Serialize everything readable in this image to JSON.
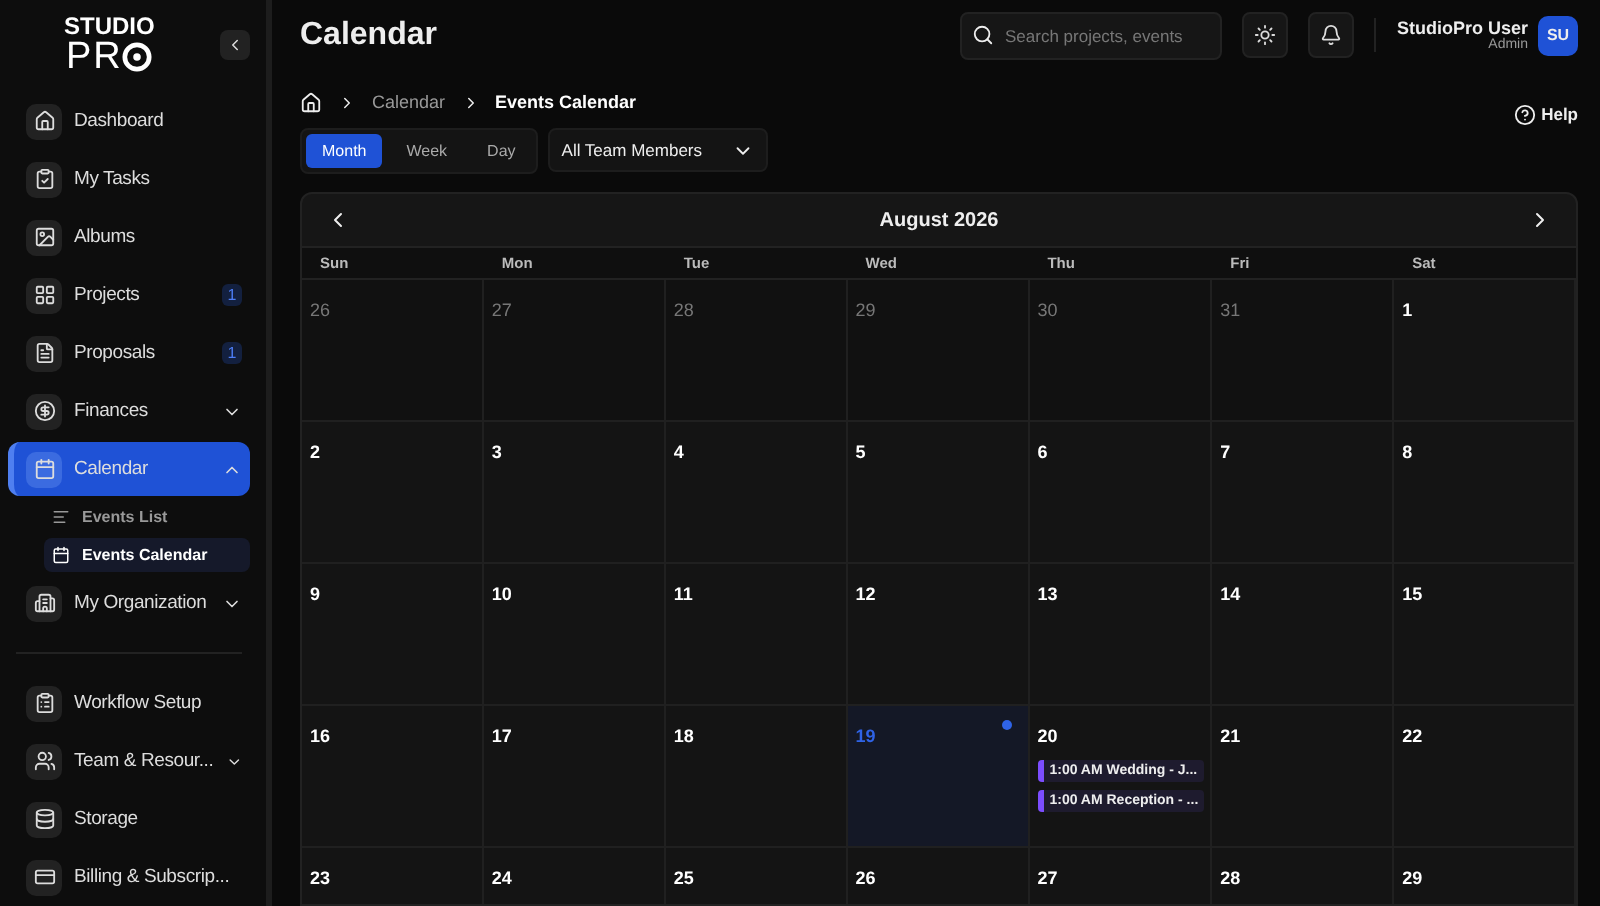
{
  "logo": {
    "line1": "STUDIO",
    "line2": "PR"
  },
  "sidebar": {
    "items": [
      {
        "label": "Dashboard",
        "selected": false
      },
      {
        "label": "My Tasks",
        "selected": false
      },
      {
        "label": "Albums",
        "selected": false
      },
      {
        "label": "Projects",
        "badge": "1",
        "selected": false
      },
      {
        "label": "Proposals",
        "badge": "1",
        "selected": false
      },
      {
        "label": "Finances",
        "expanded": false,
        "selected": false
      },
      {
        "label": "Calendar",
        "expanded": true,
        "selected": true,
        "children": [
          {
            "label": "Events List",
            "selected": false
          },
          {
            "label": "Events Calendar",
            "selected": true
          }
        ]
      },
      {
        "label": "My Organization",
        "expanded": false,
        "selected": false
      }
    ],
    "bottom_items": [
      {
        "label": "Workflow Setup",
        "selected": false
      },
      {
        "label": "Team & Resour...",
        "expanded": false,
        "selected": false
      },
      {
        "label": "Storage",
        "selected": false
      },
      {
        "label": "Billing & Subscrip...",
        "selected": false
      }
    ]
  },
  "header": {
    "title": "Calendar",
    "search": {
      "placeholder": "Search projects, events"
    },
    "user": {
      "name": "StudioPro User",
      "role": "Admin",
      "initials": "SU"
    }
  },
  "breadcrumb": [
    "Calendar",
    "Events Calendar"
  ],
  "help": "Help",
  "view_tabs": [
    {
      "label": "Month",
      "selected": true
    },
    {
      "label": "Week",
      "selected": false
    },
    {
      "label": "Day",
      "selected": false
    }
  ],
  "member_filter": "All Team Members",
  "calendar": {
    "month": "August 2026",
    "weekdays": [
      "Sun",
      "Mon",
      "Tue",
      "Wed",
      "Thu",
      "Fri",
      "Sat"
    ],
    "weeks": [
      [
        {
          "day": "26",
          "outside": true
        },
        {
          "day": "27",
          "outside": true
        },
        {
          "day": "28",
          "outside": true
        },
        {
          "day": "29",
          "outside": true
        },
        {
          "day": "30",
          "outside": true
        },
        {
          "day": "31",
          "outside": true
        },
        {
          "day": "1",
          "outside": false
        }
      ],
      [
        {
          "day": "2",
          "outside": false
        },
        {
          "day": "3",
          "outside": false
        },
        {
          "day": "4",
          "outside": false
        },
        {
          "day": "5",
          "outside": false
        },
        {
          "day": "6",
          "outside": false
        },
        {
          "day": "7",
          "outside": false
        },
        {
          "day": "8",
          "outside": false
        }
      ],
      [
        {
          "day": "9",
          "outside": false
        },
        {
          "day": "10",
          "outside": false
        },
        {
          "day": "11",
          "outside": false
        },
        {
          "day": "12",
          "outside": false
        },
        {
          "day": "13",
          "outside": false
        },
        {
          "day": "14",
          "outside": false
        },
        {
          "day": "15",
          "outside": false
        }
      ],
      [
        {
          "day": "16",
          "outside": false
        },
        {
          "day": "17",
          "outside": false
        },
        {
          "day": "18",
          "outside": false
        },
        {
          "day": "19",
          "outside": false,
          "today": true
        },
        {
          "day": "20",
          "outside": false,
          "events": [
            {
              "text": "1:00 AM Wedding - J...",
              "color": "#7c4dff"
            },
            {
              "text": "1:00 AM Reception - ...",
              "color": "#7c4dff"
            }
          ]
        },
        {
          "day": "21",
          "outside": false
        },
        {
          "day": "22",
          "outside": false
        }
      ],
      [
        {
          "day": "23",
          "outside": false
        },
        {
          "day": "24",
          "outside": false
        },
        {
          "day": "25",
          "outside": false
        },
        {
          "day": "26",
          "outside": false
        },
        {
          "day": "27",
          "outside": false
        },
        {
          "day": "28",
          "outside": false
        },
        {
          "day": "29",
          "outside": false
        }
      ]
    ]
  }
}
